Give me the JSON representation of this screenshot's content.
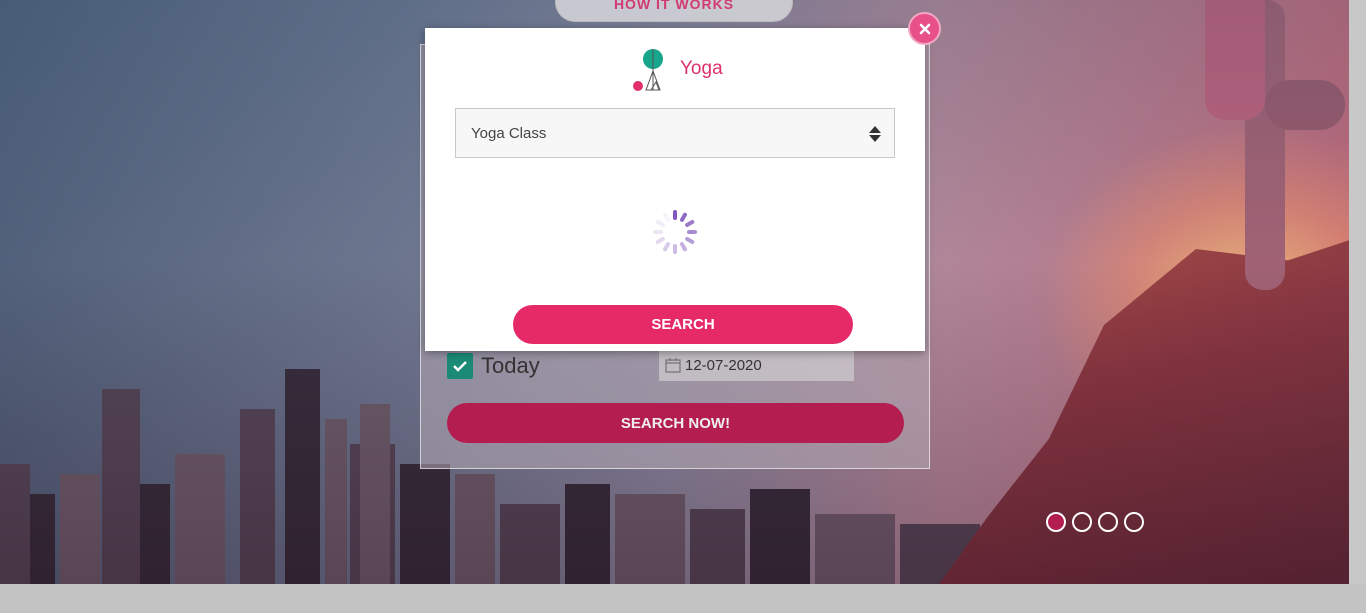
{
  "nav": {
    "how_it_works": "HOW IT WORKS"
  },
  "background_form": {
    "today_label": "Today",
    "today_checked": true,
    "date_value": "12-07-2020",
    "search_now_label": "SEARCH NOW!"
  },
  "modal": {
    "title": "Yoga",
    "category_select": {
      "selected": "Yoga Class"
    },
    "loading": true,
    "search_label": "SEARCH"
  },
  "carousel": {
    "slide_count": 4,
    "active_index": 0
  },
  "colors": {
    "brand_pink": "#e62a68",
    "dark_pink": "#b41d4f",
    "teal": "#1b8a76"
  },
  "icons": {
    "close": "close-icon",
    "logo": "yoga-logo-icon",
    "select": "sort-arrows-icon",
    "calendar": "calendar-icon",
    "check": "check-icon",
    "spinner": "loading-spinner-icon"
  }
}
